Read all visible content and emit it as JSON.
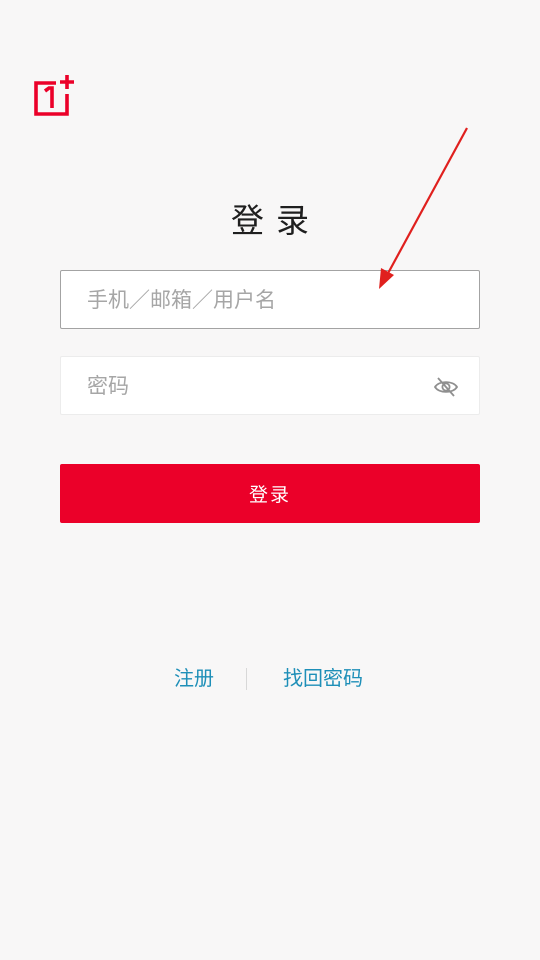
{
  "logo": {
    "icon": "oneplus-logo-icon",
    "color": "#eb0029"
  },
  "page_title": "登录",
  "username_field": {
    "placeholder": "手机／邮箱／用户名",
    "value": ""
  },
  "password_field": {
    "placeholder": "密码",
    "value": "",
    "toggle_icon": "eye-hidden-icon"
  },
  "login_button": {
    "label": "登录",
    "color": "#eb0029"
  },
  "links": {
    "register": "注册",
    "forgot_password": "找回密码",
    "color": "#1e8fb8"
  },
  "annotation": {
    "icon": "arrow-annotation",
    "color": "#e0201e"
  }
}
